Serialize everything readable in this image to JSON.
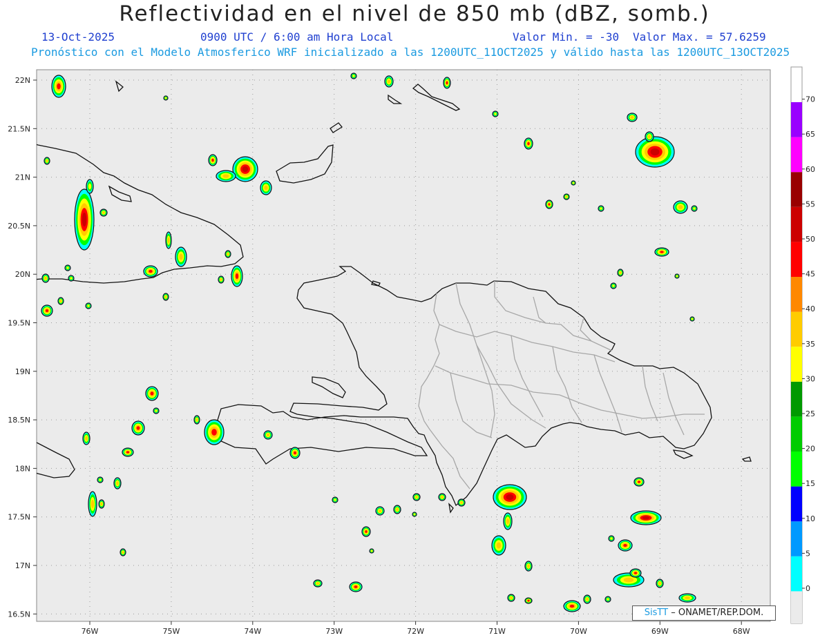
{
  "title": "Reflectividad en el nivel de 850 mb (dBZ, somb.)",
  "date": "13-Oct-2025",
  "time": "0900 UTC / 6:00 am Hora Local",
  "min_label": "Valor Min. = -30",
  "max_label": "Valor Max. = 57.6259",
  "subtitle": "Pronóstico con el Modelo Atmosferico WRF inicializado a las 1200UTC_11OCT2025 y válido hasta las  1200UTC_13OCT2025",
  "lat_labels": [
    "22N",
    "21.5N",
    "21N",
    "20.5N",
    "20N",
    "19.5N",
    "19N",
    "18.5N",
    "18N",
    "17.5N",
    "17N",
    "16.5N"
  ],
  "lon_labels": [
    "76W",
    "75W",
    "74W",
    "73W",
    "72W",
    "71W",
    "70W",
    "69W",
    "68W"
  ],
  "credit": {
    "brand": "SisTT",
    "text": "– ONAMET/REP.DOM."
  },
  "colorbar": {
    "ticks": [
      "0",
      "5",
      "10",
      "15",
      "20",
      "25",
      "30",
      "35",
      "40",
      "45",
      "50",
      "55",
      "60",
      "65",
      "70"
    ],
    "colors": [
      "#00ffff",
      "#0099ff",
      "#0000ff",
      "#00ff00",
      "#00cc00",
      "#009900",
      "#ffff00",
      "#ffcc00",
      "#ff8800",
      "#ff0000",
      "#cc0000",
      "#990000",
      "#ff00ff",
      "#9900ff"
    ]
  }
}
